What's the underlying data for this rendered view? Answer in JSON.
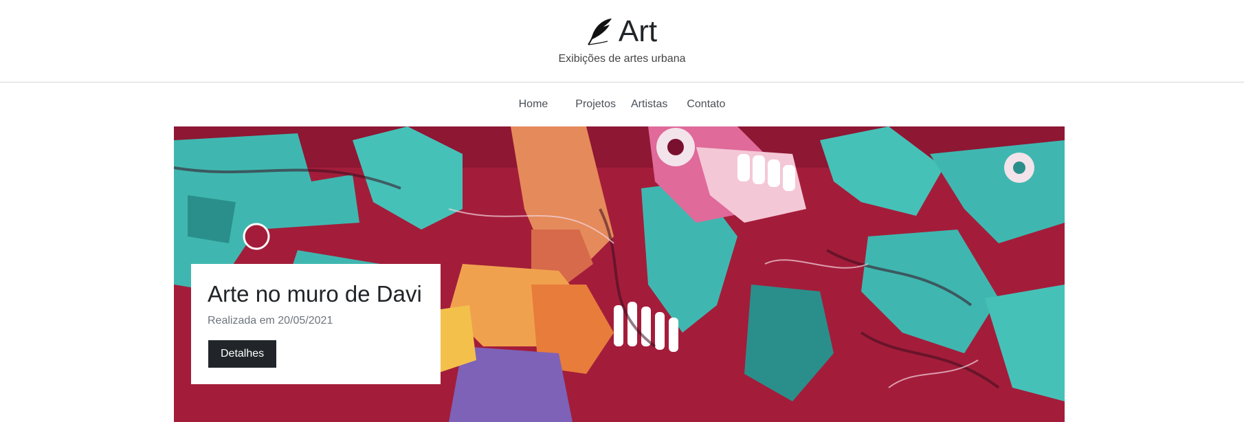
{
  "header": {
    "logo_icon": "feather-icon",
    "title": "Art",
    "tagline": "Exibições de artes urbana"
  },
  "nav": {
    "items": [
      {
        "label": "Home"
      },
      {
        "label": "Projetos"
      },
      {
        "label": "Artistas"
      },
      {
        "label": "Contato"
      }
    ]
  },
  "hero": {
    "image": "graffiti-mural",
    "card": {
      "title": "Arte no muro de Davi",
      "subtitle": "Realizada em 20/05/2021",
      "button_label": "Detalhes"
    }
  },
  "colors": {
    "text": "#212529",
    "button_bg": "#212529",
    "button_text": "#ffffff",
    "mural_teal": "#3fb7b0",
    "mural_crimson": "#a31d3a"
  }
}
